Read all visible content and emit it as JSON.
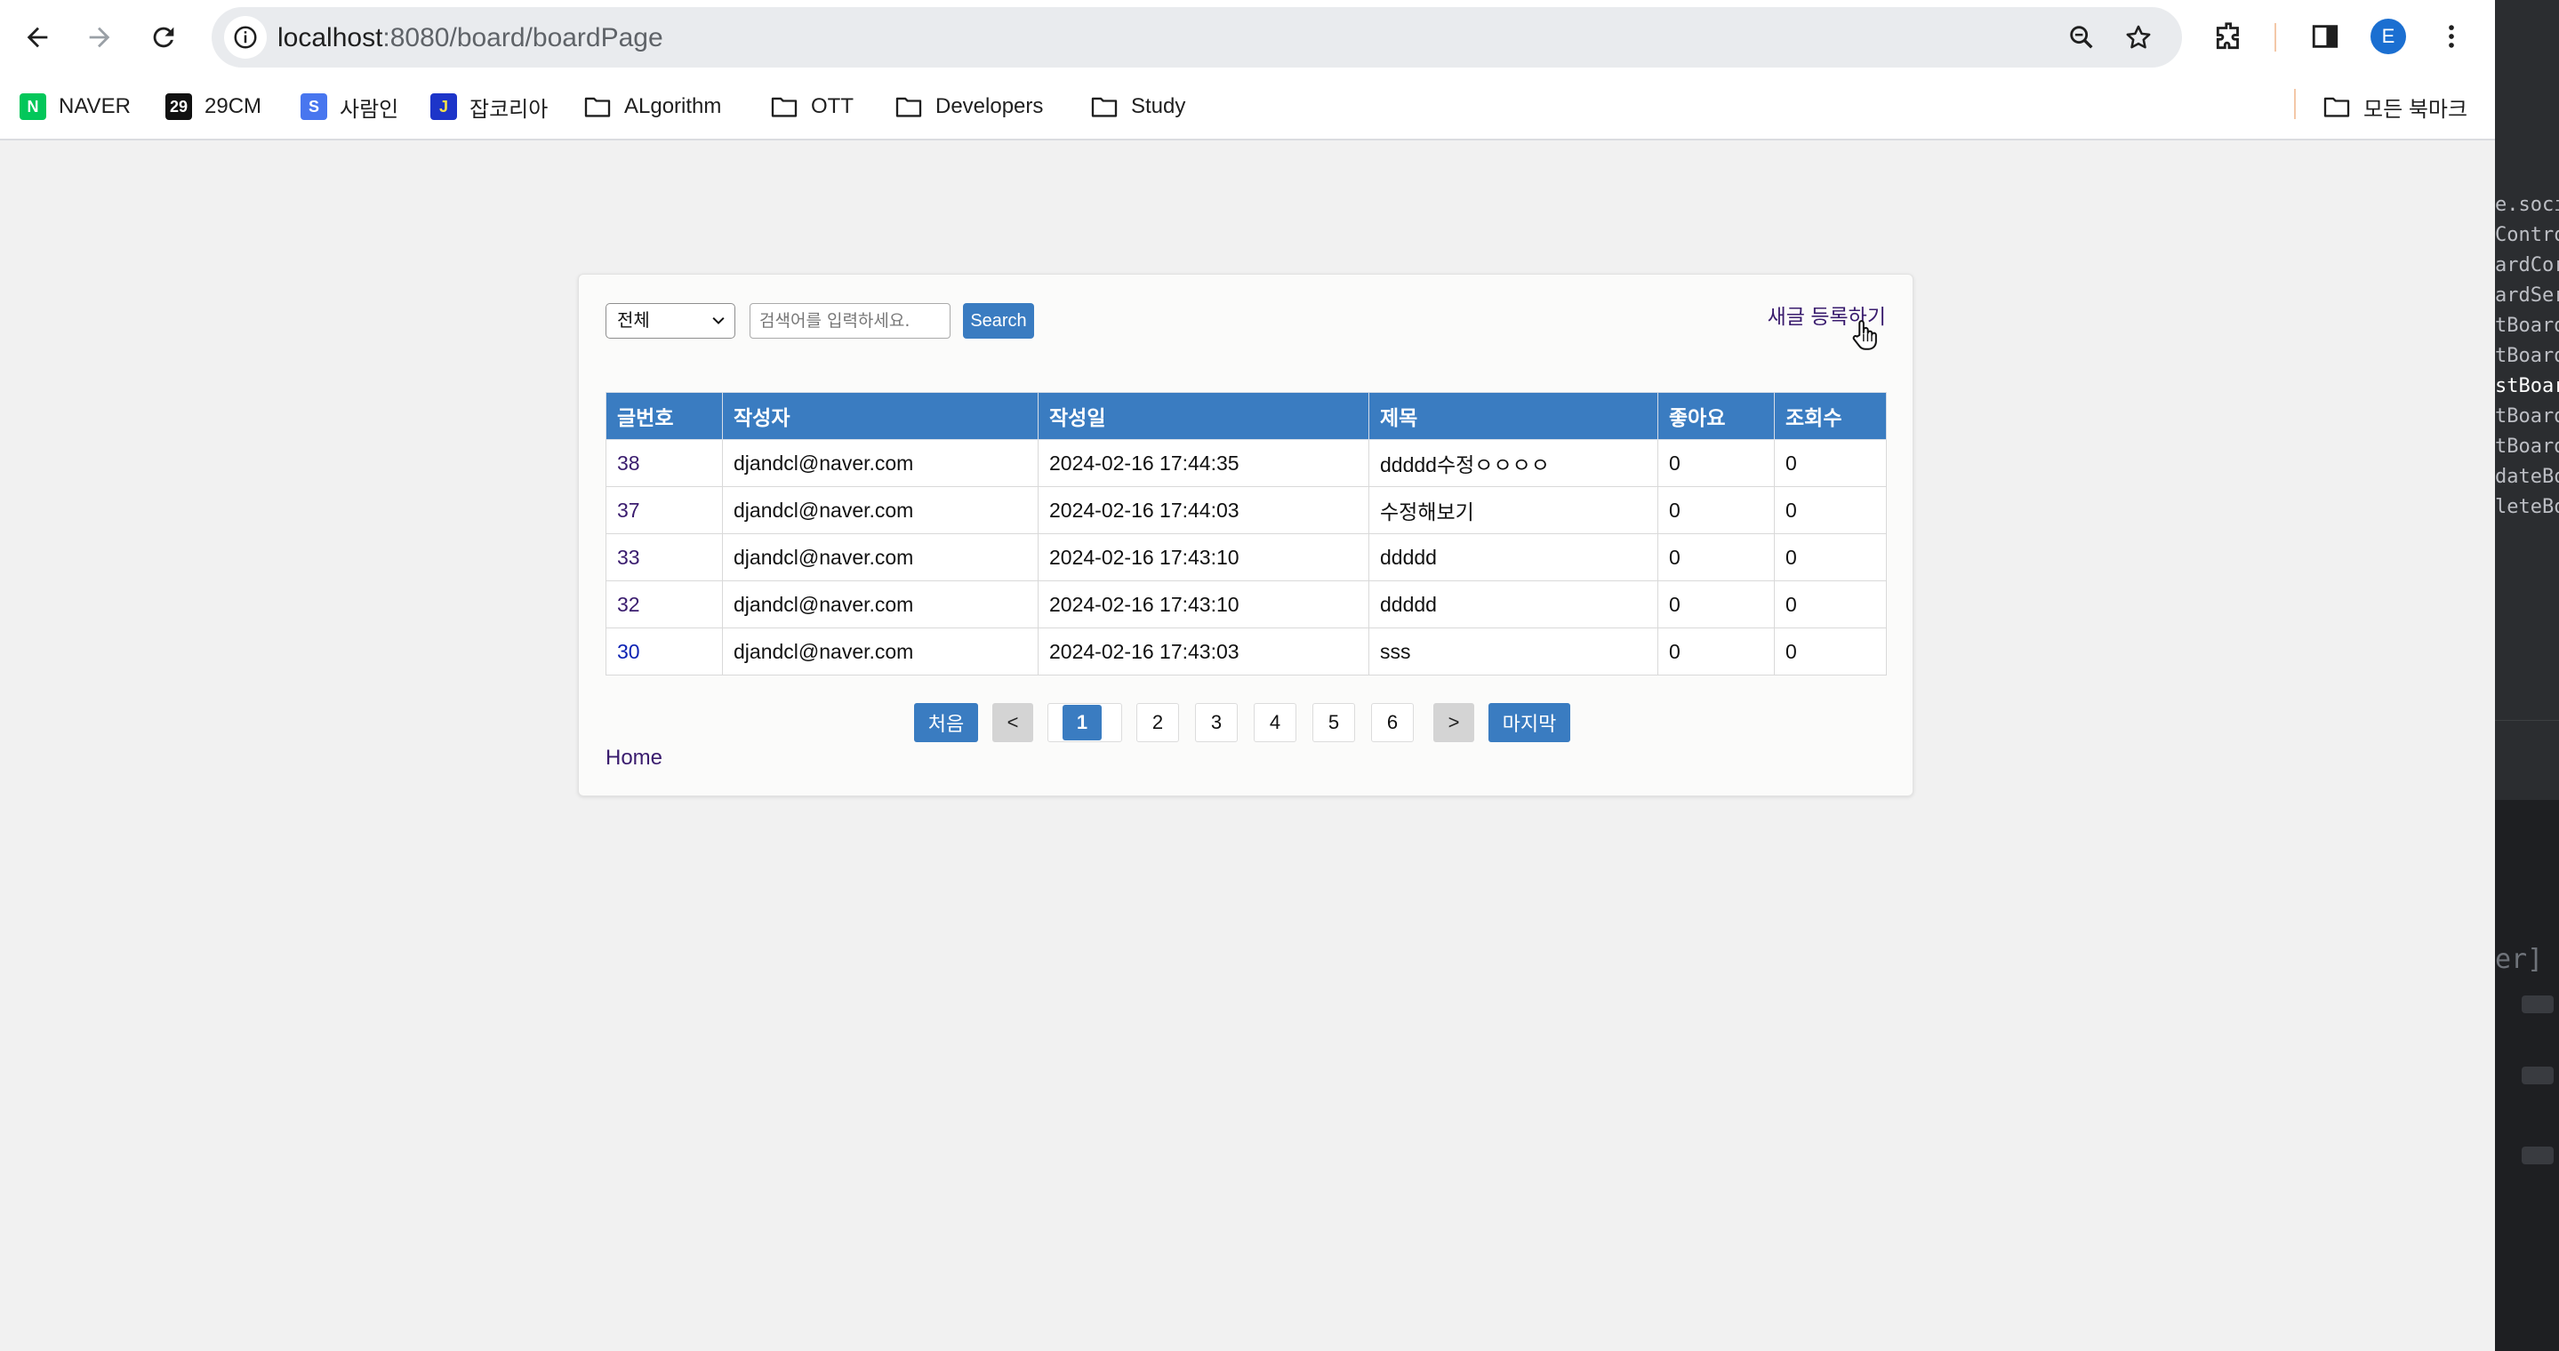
{
  "browser": {
    "url_host": "localhost",
    "url_path": ":8080/board/boardPage",
    "profile_initial": "E",
    "bookmarks": [
      {
        "label": "NAVER",
        "favicon_text": "N",
        "favicon_color": "#03c75a"
      },
      {
        "label": "29CM",
        "favicon_text": "29",
        "favicon_color": "#111111"
      },
      {
        "label": "사람인",
        "favicon_text": "S",
        "favicon_color": "#4876ef"
      },
      {
        "label": "잡코리아",
        "favicon_text": "J",
        "favicon_color": "#1d35c9"
      },
      {
        "label": "ALgorithm"
      },
      {
        "label": "OTT"
      },
      {
        "label": "Developers"
      },
      {
        "label": "Study"
      }
    ],
    "all_bookmarks_label": "모든 북마크"
  },
  "board": {
    "search": {
      "type_selected": "전체",
      "placeholder": "검색어를 입력하세요.",
      "button_label": "Search"
    },
    "new_post_label": "새글 등록하기",
    "columns": [
      "글번호",
      "작성자",
      "작성일",
      "제목",
      "좋아요",
      "조회수"
    ],
    "rows": [
      {
        "id": "38",
        "author": "djandcl@naver.com",
        "date": "2024-02-16 17:44:35",
        "title": "ddddd수정ㅇㅇㅇㅇ",
        "likes": "0",
        "views": "0"
      },
      {
        "id": "37",
        "author": "djandcl@naver.com",
        "date": "2024-02-16 17:44:03",
        "title": "수정해보기",
        "likes": "0",
        "views": "0"
      },
      {
        "id": "33",
        "author": "djandcl@naver.com",
        "date": "2024-02-16 17:43:10",
        "title": "ddddd",
        "likes": "0",
        "views": "0"
      },
      {
        "id": "32",
        "author": "djandcl@naver.com",
        "date": "2024-02-16 17:43:10",
        "title": "ddddd",
        "likes": "0",
        "views": "0"
      },
      {
        "id": "30",
        "author": "djandcl@naver.com",
        "date": "2024-02-16 17:43:03",
        "title": "sss",
        "likes": "0",
        "views": "0"
      }
    ],
    "pagination": {
      "first_label": "처음",
      "prev_label": "<",
      "pages": [
        "1",
        "2",
        "3",
        "4",
        "5",
        "6"
      ],
      "current_page": "1",
      "next_label": ">",
      "last_label": "마지막"
    },
    "home_link": "Home"
  },
  "ide": {
    "lines": [
      "e.socia",
      "Contro",
      "ardCor",
      "ardSer",
      "tBoard",
      "tBoard",
      "stBoard",
      "tBoard",
      "tBoard",
      "dateBo",
      "leteBo"
    ],
    "bracket_text": "er]"
  },
  "colors": {
    "accent_blue": "#3a7cc1",
    "visited_link": "#3a1c6e",
    "unvisited_link": "#0d23b3"
  }
}
